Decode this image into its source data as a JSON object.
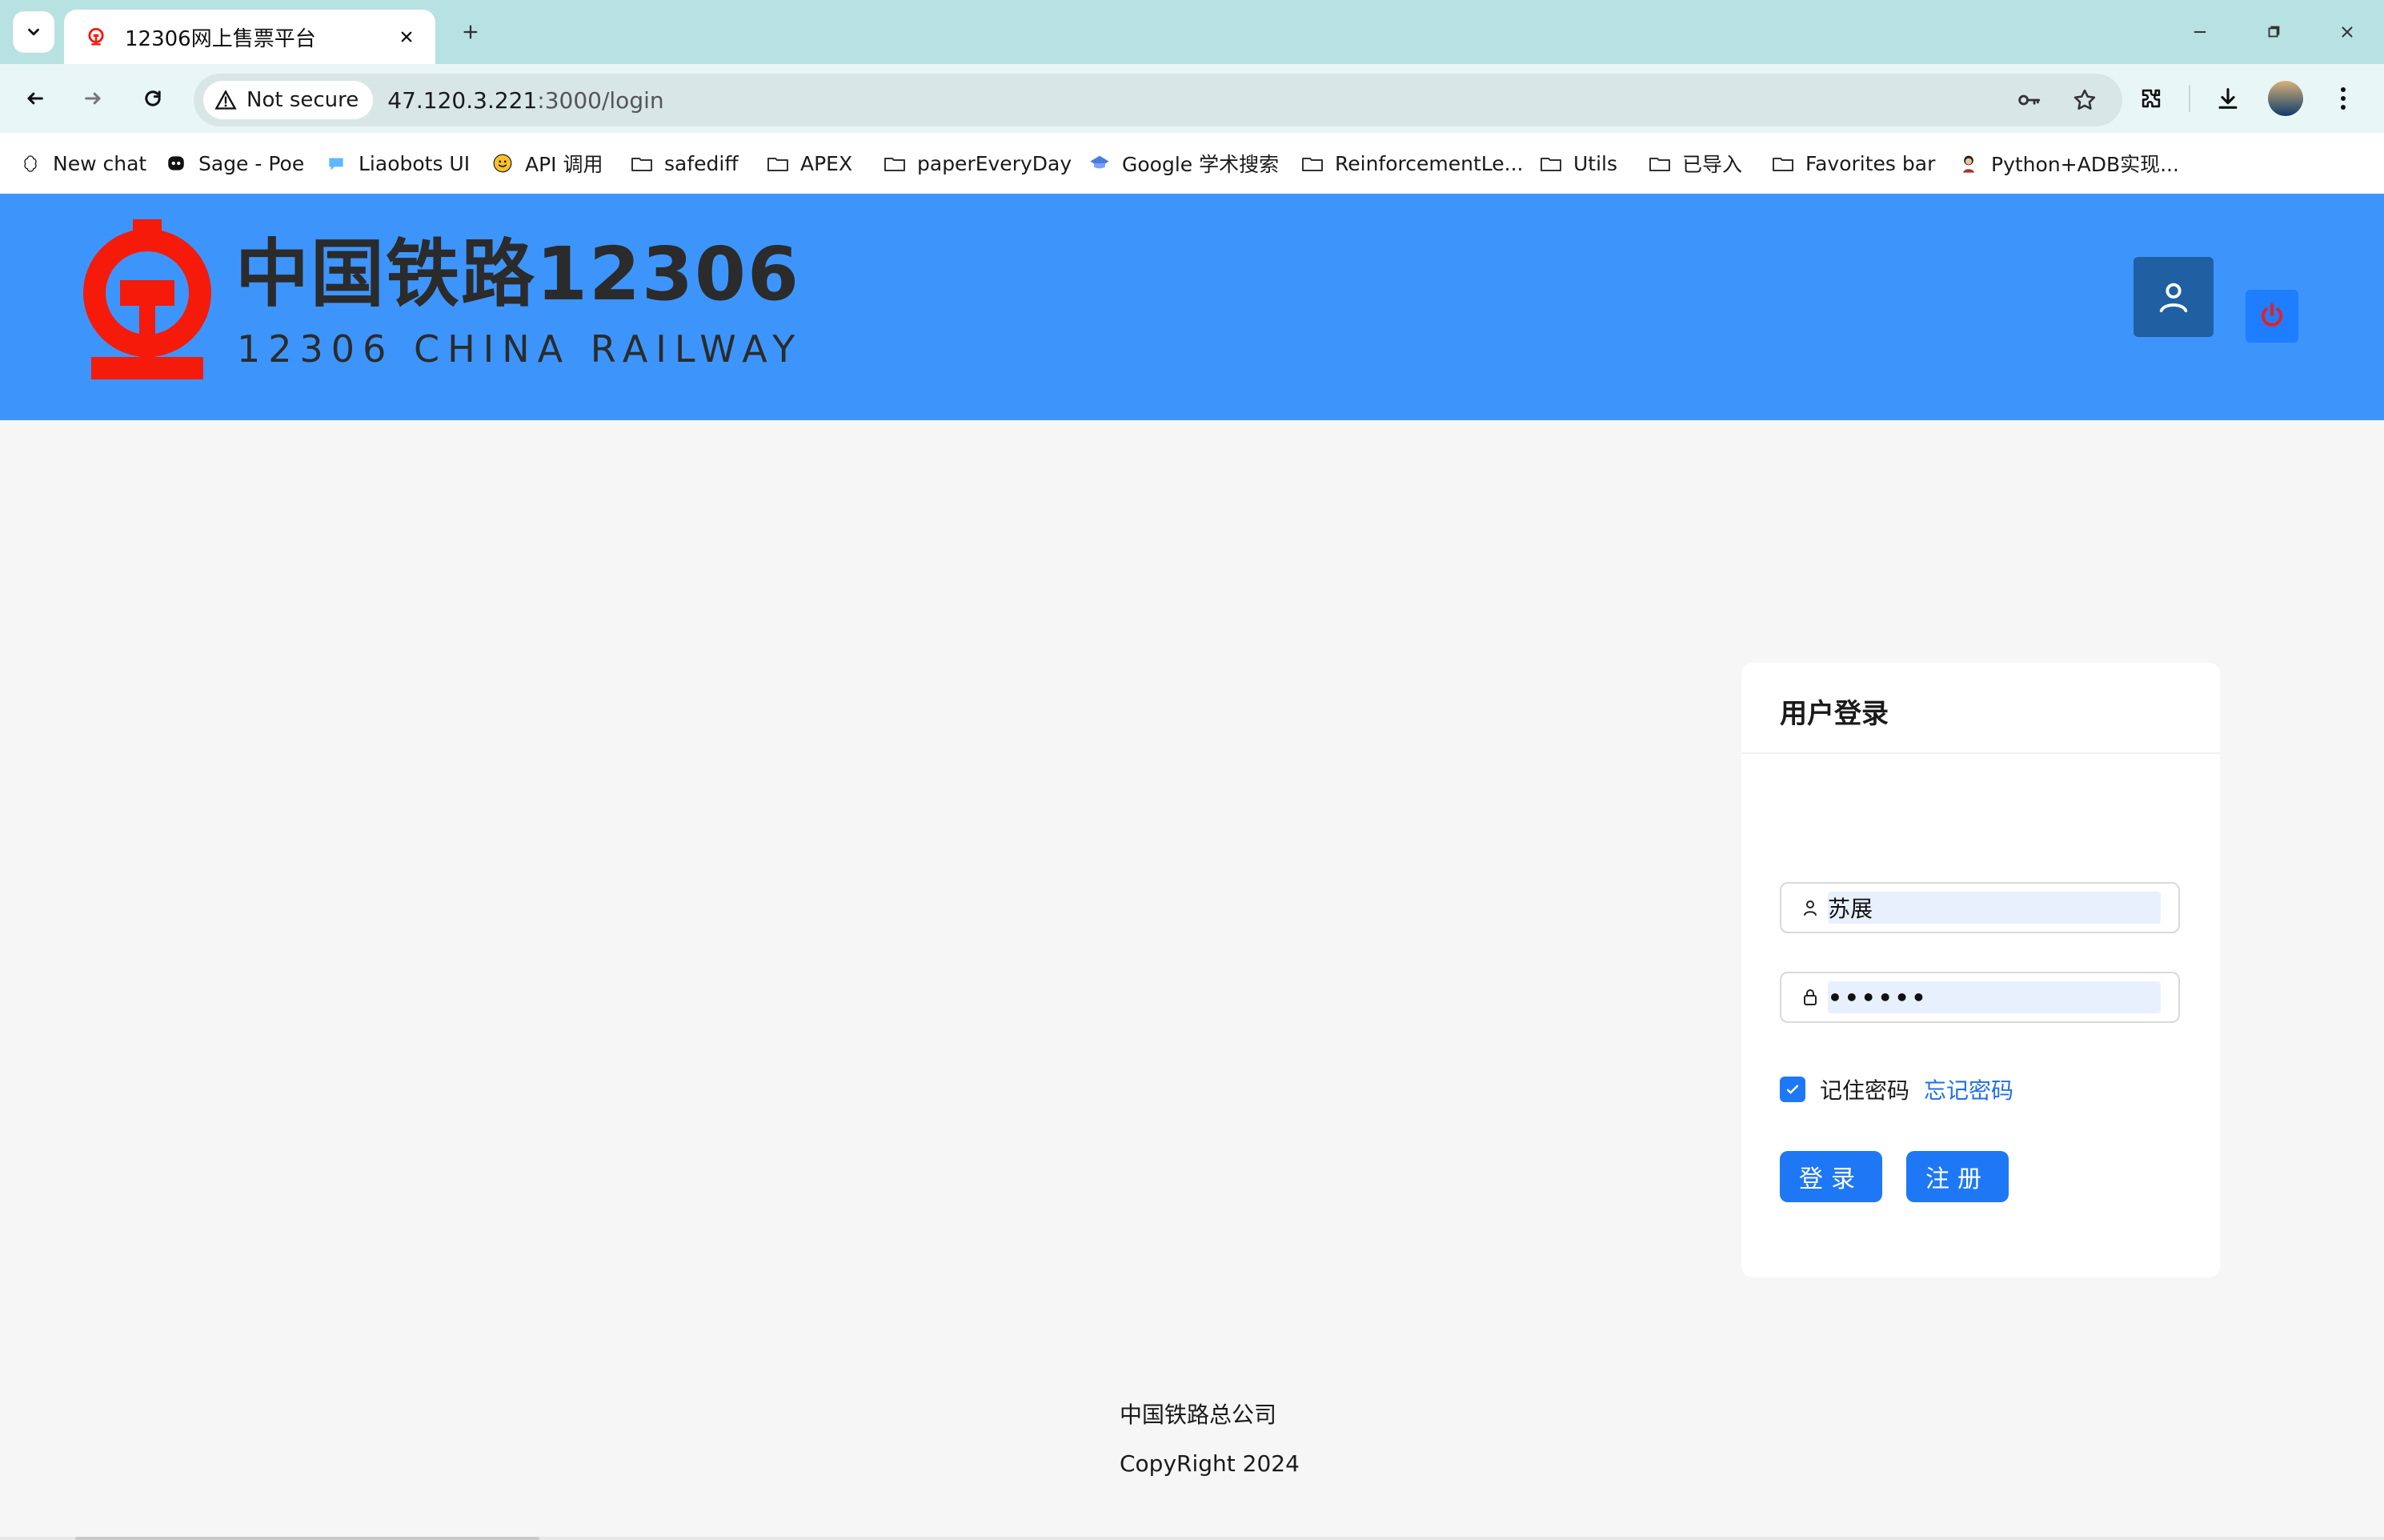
{
  "browser": {
    "tab": {
      "title": "12306网上售票平台"
    },
    "address": {
      "security_label": "Not secure",
      "host": "47.120.3.221",
      "path": ":3000/login"
    },
    "bookmarks": [
      {
        "label": "New chat",
        "icon": "chatgpt-icon"
      },
      {
        "label": "Sage - Poe",
        "icon": "poe-icon"
      },
      {
        "label": "Liaobots UI",
        "icon": "speech-bubble-icon"
      },
      {
        "label": "API 调用",
        "icon": "smile-icon"
      },
      {
        "label": "safediff",
        "icon": "folder-icon"
      },
      {
        "label": "APEX",
        "icon": "folder-icon"
      },
      {
        "label": "paperEveryDay",
        "icon": "folder-icon"
      },
      {
        "label": "Google 学术搜索",
        "icon": "scholar-icon"
      },
      {
        "label": "ReinforcementLe...",
        "icon": "folder-icon"
      },
      {
        "label": "Utils",
        "icon": "folder-icon"
      },
      {
        "label": "已导入",
        "icon": "folder-icon"
      },
      {
        "label": "Favorites bar",
        "icon": "folder-icon"
      },
      {
        "label": "Python+ADB实现...",
        "icon": "avatar-icon"
      }
    ]
  },
  "site": {
    "brand": {
      "cn": "中国铁路12306",
      "en": "12306 CHINA RAILWAY"
    },
    "colors": {
      "header_bg": "#3D95FB",
      "primary": "#1E78F5",
      "logo_red": "#F51A0A",
      "power_red": "#F21A1A"
    }
  },
  "login": {
    "title": "用户登录",
    "username": {
      "value": "苏展",
      "icon": "user-icon"
    },
    "password": {
      "value": "••••••",
      "icon": "lock-icon"
    },
    "remember": {
      "checked": true,
      "label": "记住密码"
    },
    "forgot_link": "忘记密码",
    "login_button": "登录",
    "register_button": "注册"
  },
  "footer": {
    "company": "中国铁路总公司",
    "copyright": "CopyRight 2024"
  }
}
